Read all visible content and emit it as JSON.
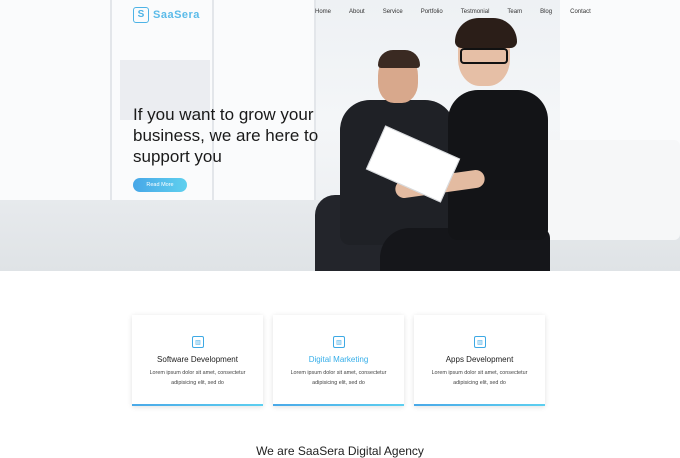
{
  "brand": {
    "name": "SaaSera",
    "icon": "logo-s-icon",
    "accent": "#4db3e6"
  },
  "nav": [
    "Home",
    "About",
    "Service",
    "Portfolio",
    "Testmonial",
    "Team",
    "Blog",
    "Contact"
  ],
  "hero": {
    "headline": "If you want to grow your business, we are here to support you",
    "button_label": "Read More"
  },
  "services": [
    {
      "title": "Software Development",
      "desc": "Lorem ipsum dolor sit amet, consectetur adipisicing elit, sed do",
      "icon": "chart-icon"
    },
    {
      "title": "Digital Marketing",
      "desc": "Lorem ipsum dolor sit amet, consectetur adipisicing elit, sed do",
      "icon": "chart-icon",
      "active": true
    },
    {
      "title": "Apps Development",
      "desc": "Lorem ipsum dolor sit amet, consectetur adipisicing elit, sed do",
      "icon": "chart-icon"
    }
  ],
  "section_heading": "We are SaaSera Digital Agency"
}
